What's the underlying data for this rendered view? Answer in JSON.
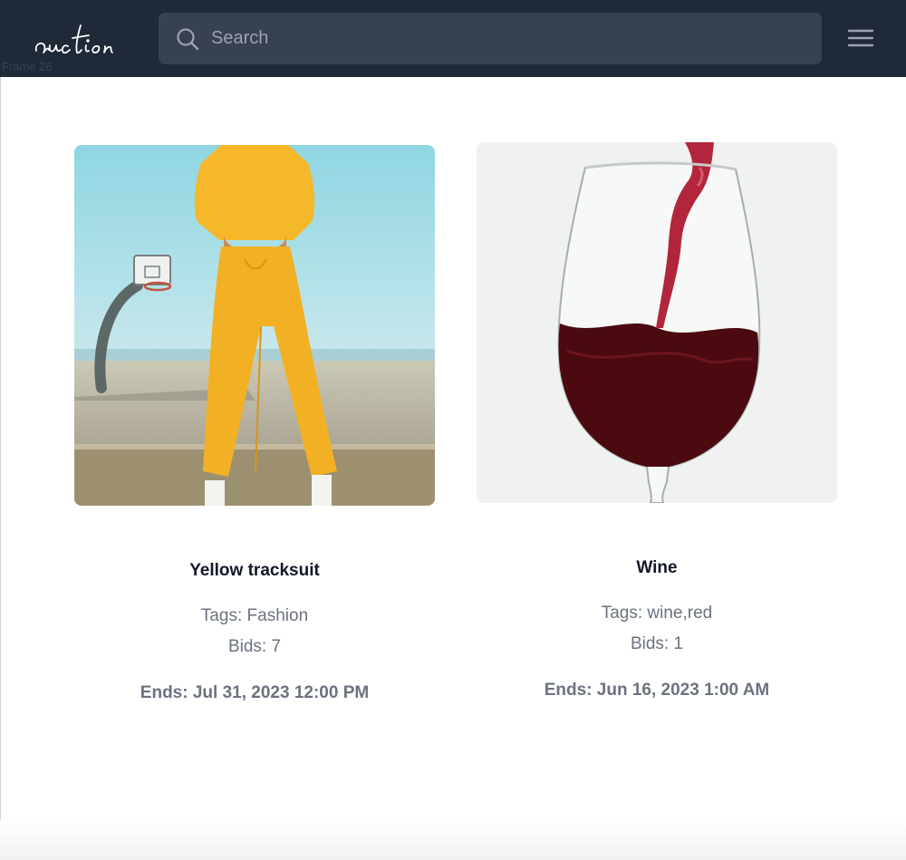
{
  "header": {
    "logo_text": "auction",
    "search": {
      "placeholder": "Search",
      "value": ""
    },
    "menu_icon": "hamburger-icon"
  },
  "frame_label": "Frame 26",
  "auctions": [
    {
      "title": "Yellow tracksuit",
      "tags": "Tags: Fashion",
      "bids": "Bids: 7",
      "ends": "Ends: Jul 31, 2023 12:00 PM"
    },
    {
      "title": "Wine",
      "tags": "Tags: wine,red",
      "bids": "Bids: 1",
      "ends": "Ends: Jun 16, 2023 1:00 AM"
    }
  ],
  "colors": {
    "navbar": "#1f2937",
    "search_bg": "#374151",
    "muted_text": "#6b7280",
    "title_text": "#111827"
  }
}
